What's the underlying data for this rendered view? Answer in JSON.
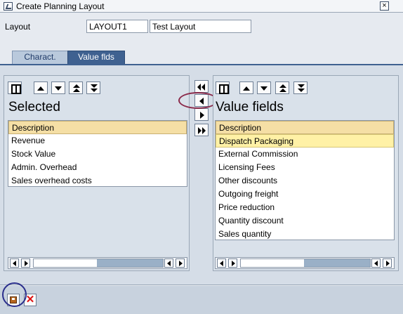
{
  "window": {
    "title": "Create Planning Layout",
    "close_glyph": "×"
  },
  "header": {
    "layout_label": "Layout",
    "layout_code": "LAYOUT1",
    "layout_description": "Test Layout"
  },
  "tabs": [
    {
      "label": "Charact.",
      "active": false
    },
    {
      "label": "Value flds",
      "active": true
    }
  ],
  "left_panel": {
    "heading": "Selected",
    "header_row": "Description",
    "items": [
      "Revenue",
      "Stock Value",
      "Admin. Overhead",
      "Sales overhead costs"
    ]
  },
  "right_panel": {
    "heading": "Value fields",
    "header_row": "Description",
    "items": [
      "Dispatch Packaging",
      "External Commission",
      "Licensing Fees",
      "Other discounts",
      "Outgoing freight",
      "Price reduction",
      "Quantity discount",
      "Sales quantity"
    ],
    "selected_index": 0
  },
  "colors": {
    "active_tab": "#3f6190",
    "header_row": "#f5dfa5",
    "selected_row": "#fff1a6",
    "annotation_ellipse": "#8b2a4a",
    "annotation_circle": "#2a2e8c"
  },
  "icons": {
    "find": "find-icon",
    "move_up": "arrow-up-icon",
    "move_down": "arrow-down-icon",
    "move_top": "double-arrow-up-icon",
    "move_bottom": "double-arrow-down-icon",
    "save": "save-icon",
    "cancel": "cancel-icon"
  }
}
